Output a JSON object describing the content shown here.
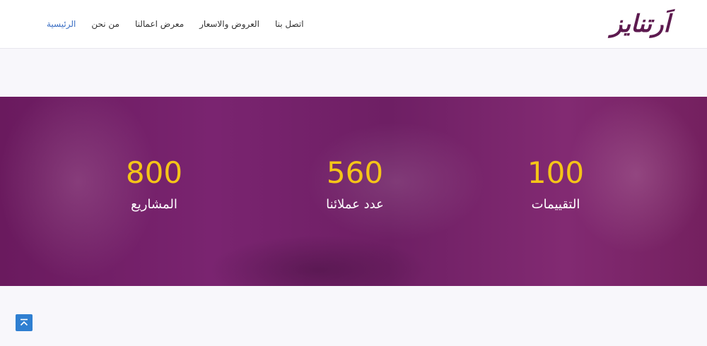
{
  "header": {
    "logo_text": "اَرتنايز",
    "nav": [
      {
        "label": "الرئيسية",
        "active": true
      },
      {
        "label": "من نحن",
        "active": false
      },
      {
        "label": "معرض اعمالنا",
        "active": false
      },
      {
        "label": "العروض والاسعار",
        "active": false
      },
      {
        "label": "اتصل بنا",
        "active": false
      }
    ]
  },
  "stats": [
    {
      "value": "100",
      "label": "التقييمات"
    },
    {
      "value": "560",
      "label": "عدد عملائنا"
    },
    {
      "value": "800",
      "label": "المشاريع"
    }
  ],
  "colors": {
    "accent_number": "#f5c518",
    "overlay": "#7a2470",
    "logo": "#5d1a4f",
    "active_nav": "#3b6fc4",
    "scroll_button": "#2f7fd1"
  },
  "icons": {
    "scroll_top": "chevron-up-icon"
  }
}
